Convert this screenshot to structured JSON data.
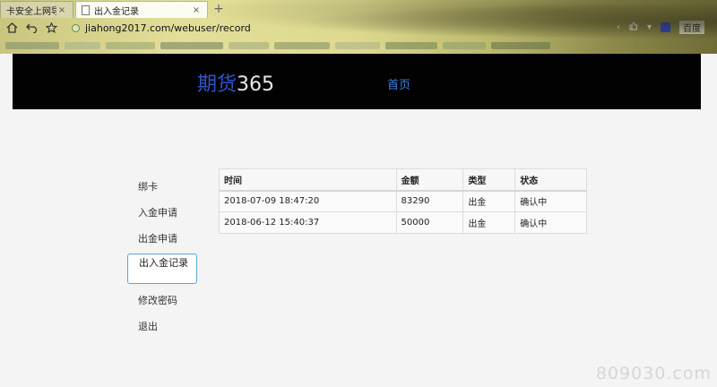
{
  "browser": {
    "tabs": [
      {
        "title": "卡安全上网导航",
        "close": "×",
        "active": false
      },
      {
        "title": "出入金记录",
        "close": "×",
        "active": true
      }
    ],
    "new_tab": "+",
    "url": "jiahong2017.com/webuser/record",
    "search_engine": "百度"
  },
  "site": {
    "logo_part1": "期货",
    "logo_part2": "365",
    "home": "首页"
  },
  "sidebar": {
    "items": [
      {
        "label": "绑卡"
      },
      {
        "label": "入金申请"
      },
      {
        "label": "出金申请"
      },
      {
        "label": "出入金记录",
        "active": true
      },
      {
        "label": "修改密码"
      },
      {
        "label": "退出"
      }
    ]
  },
  "records": {
    "headers": [
      "时间",
      "金额",
      "类型",
      "状态"
    ],
    "rows": [
      [
        "2018-07-09 18:47:20",
        "83290",
        "出金",
        "确认中"
      ],
      [
        "2018-06-12 15:40:37",
        "50000",
        "出金",
        "确认中"
      ]
    ]
  },
  "watermark": "809030.com",
  "colors": {
    "header_bg": "#020202",
    "logo_blue": "#2e55c8",
    "link_blue": "#3b82e0",
    "active_border": "#5aa6d6"
  }
}
